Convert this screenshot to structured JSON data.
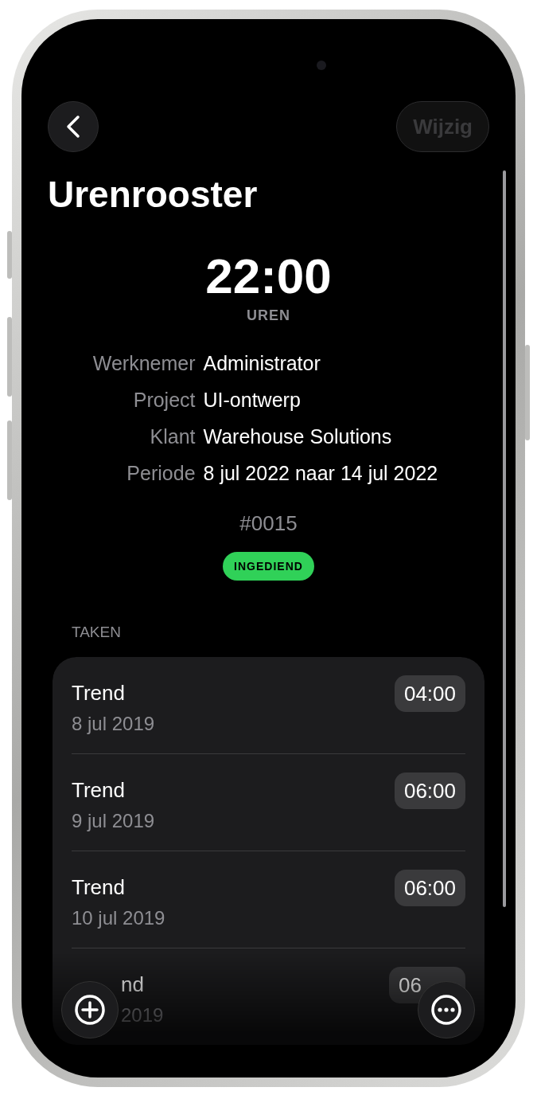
{
  "navigation": {
    "edit_button": {
      "label": "Wijzig",
      "disabled": true
    }
  },
  "title": "Urenrooster",
  "total": {
    "value": "22:00",
    "unit": "UREN"
  },
  "details": [
    {
      "label": "Werknemer",
      "value": "Administrator"
    },
    {
      "label": "Project",
      "value": "UI-ontwerp"
    },
    {
      "label": "Klant",
      "value": "Warehouse Solutions"
    },
    {
      "label": "Periode",
      "value": "8 jul 2022 naar 14 jul 2022"
    }
  ],
  "number": "#0015",
  "status": {
    "label": "INGEDIEND",
    "kind": "submitted"
  },
  "section_label": "TAKEN",
  "tasks": [
    {
      "title": "Trend",
      "date": "8 jul 2019",
      "duration": "04:00",
      "kind": "full"
    },
    {
      "title": "Trend",
      "date": "9 jul 2019",
      "duration": "06:00",
      "kind": "full"
    },
    {
      "title": "Trend",
      "date": "10 jul 2019",
      "duration": "06:00",
      "kind": "full"
    },
    {
      "title": "nd",
      "date": "2019",
      "duration": "06",
      "kind": "partial"
    }
  ]
}
